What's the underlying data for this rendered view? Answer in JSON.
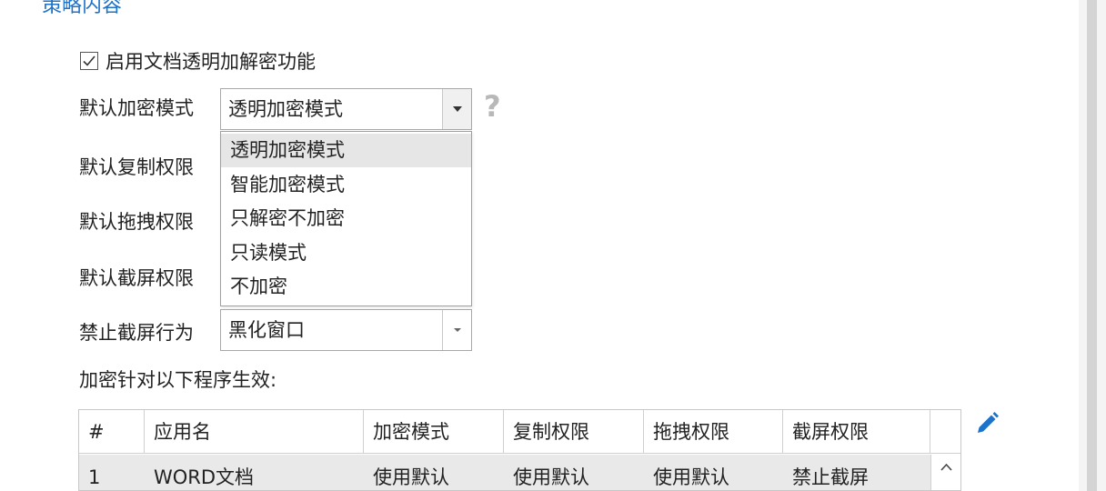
{
  "section": {
    "title": "策略内容"
  },
  "enable": {
    "checked": true,
    "label": "启用文档透明加解密功能"
  },
  "labels": {
    "default_encrypt_mode": "默认加密模式",
    "default_copy_perm": "默认复制权限",
    "default_drag_perm": "默认拖拽权限",
    "default_screenshot_perm": "默认截屏权限",
    "forbid_screenshot_behavior": "禁止截屏行为"
  },
  "encrypt_mode_select": {
    "value": "透明加密模式",
    "help_icon": "question-mark-icon",
    "options": [
      "透明加密模式",
      "智能加密模式",
      "只解密不加密",
      "只读模式",
      "不加密"
    ],
    "highlighted_index": 0
  },
  "forbid_select": {
    "value": "黑化窗口"
  },
  "program_list": {
    "heading": "加密针对以下程序生效:",
    "columns": [
      "#",
      "应用名",
      "加密模式",
      "复制权限",
      "拖拽权限",
      "截屏权限"
    ],
    "rows": [
      [
        "1",
        "WORD文档",
        "使用默认",
        "使用默认",
        "使用默认",
        "禁止截屏"
      ]
    ],
    "edit_icon": "pencil-icon"
  },
  "colors": {
    "accent": "#1e73c9",
    "selected_row": "#e6e6e6",
    "table_row": "#e9e9e9"
  }
}
